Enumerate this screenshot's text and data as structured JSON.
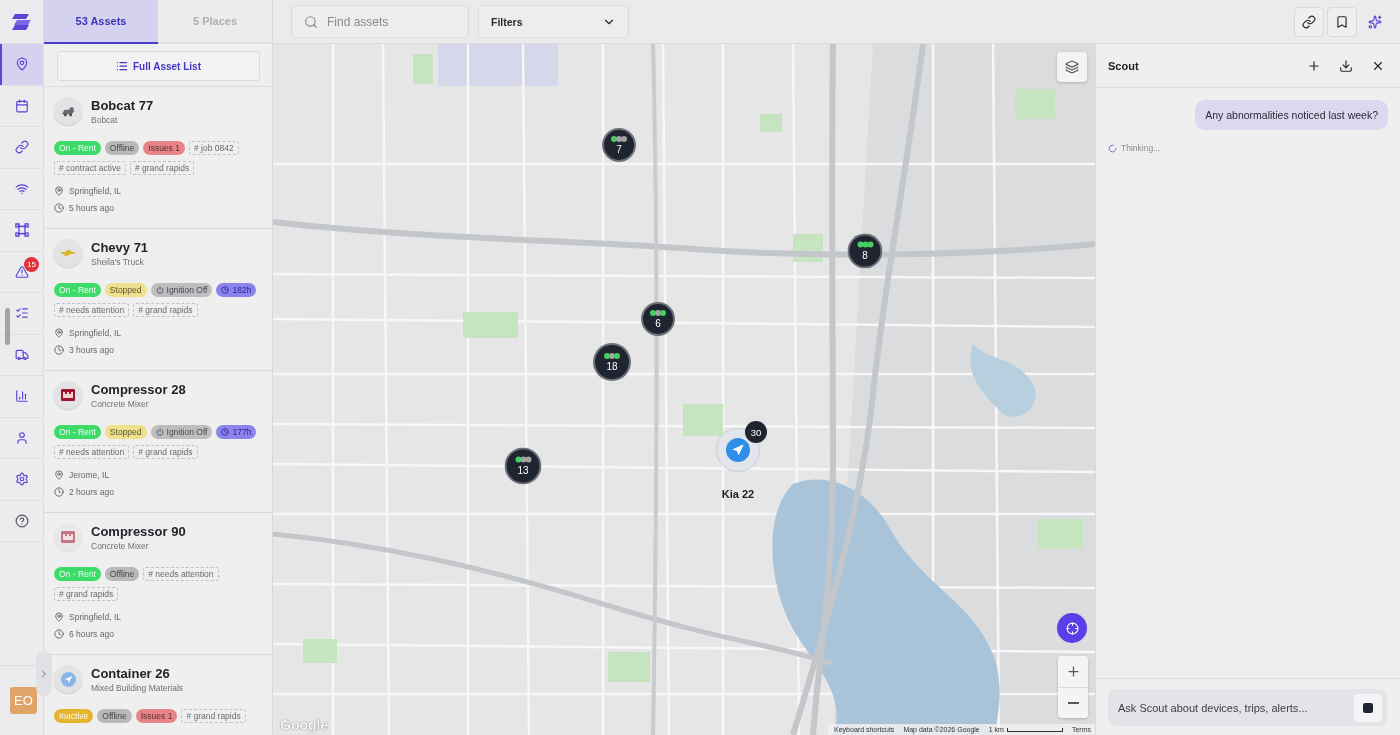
{
  "rail": {
    "nav": [
      {
        "selected": true
      },
      {
        "selected": false
      },
      {
        "selected": false
      },
      {
        "selected": false
      },
      {
        "selected": false
      },
      {
        "selected": false,
        "badge": "15"
      },
      {
        "selected": false
      },
      {
        "selected": false
      },
      {
        "selected": false
      },
      {
        "selected": false
      },
      {
        "selected": false
      },
      {
        "selected": false
      }
    ],
    "avatar": "EO"
  },
  "asset_panel": {
    "tabs": [
      {
        "label": "53 Assets",
        "selected": true
      },
      {
        "label": "5 Places",
        "selected": false
      }
    ],
    "full_list_button": "Full Asset List",
    "assets": [
      {
        "name": "Bobcat 77",
        "subtitle": "Bobcat",
        "tags": [
          {
            "kind": "status",
            "label": "On - Rent",
            "color": "#3ddc6a"
          },
          {
            "kind": "status",
            "label": "Offline",
            "color": "#b9b9b9"
          },
          {
            "kind": "status",
            "label": "Issues 1",
            "color": "#e88388"
          },
          {
            "kind": "hashtag",
            "label": "# job 0842"
          },
          {
            "kind": "hashtag",
            "label": "# contract active"
          },
          {
            "kind": "hashtag",
            "label": "# grand rapids"
          }
        ],
        "location": "Springfield, IL",
        "last_seen": "5 hours ago"
      },
      {
        "name": "Chevy 71",
        "subtitle": "Sheila's Truck",
        "tags": [
          {
            "kind": "status",
            "label": "On - Rent",
            "color": "#3ddc6a"
          },
          {
            "kind": "status",
            "label": "Stopped",
            "color": "#efe08c"
          },
          {
            "kind": "ignition",
            "label": "Ignition Off"
          },
          {
            "kind": "hours",
            "label": "182h"
          },
          {
            "kind": "hashtag",
            "label": "# needs attention"
          },
          {
            "kind": "hashtag",
            "label": "# grand rapids"
          }
        ],
        "location": "Springfield, IL",
        "last_seen": "3 hours ago"
      },
      {
        "name": "Compressor 28",
        "subtitle": "Concrete Mixer",
        "tags": [
          {
            "kind": "status",
            "label": "On - Rent",
            "color": "#3ddc6a"
          },
          {
            "kind": "status",
            "label": "Stopped",
            "color": "#efe08c"
          },
          {
            "kind": "ignition",
            "label": "Ignition Off"
          },
          {
            "kind": "hours",
            "label": "177h"
          },
          {
            "kind": "hashtag",
            "label": "# needs attention"
          },
          {
            "kind": "hashtag",
            "label": "# grand rapids"
          }
        ],
        "location": "Jerome, IL",
        "last_seen": "2 hours ago"
      },
      {
        "name": "Compressor 90",
        "subtitle": "Concrete Mixer",
        "tags": [
          {
            "kind": "status",
            "label": "On - Rent",
            "color": "#3ddc6a"
          },
          {
            "kind": "status",
            "label": "Offline",
            "color": "#b9b9b9"
          },
          {
            "kind": "hashtag",
            "label": "# needs attention"
          },
          {
            "kind": "hashtag",
            "label": "# grand rapids"
          }
        ],
        "location": "Springfield, IL",
        "last_seen": "6 hours ago"
      },
      {
        "name": "Container 26",
        "subtitle": "Mixed Building Materials",
        "tags": [
          {
            "kind": "status",
            "label": "Inactive",
            "color": "#e3b52e"
          },
          {
            "kind": "status",
            "label": "Offline",
            "color": "#b9b9b9"
          },
          {
            "kind": "status",
            "label": "Issues 1",
            "color": "#e88388"
          },
          {
            "kind": "hashtag",
            "label": "# grand rapids"
          }
        ]
      }
    ]
  },
  "top_bar": {
    "search": {
      "placeholder": "Find assets"
    },
    "filter": {
      "label": "Filters"
    }
  },
  "map": {
    "clusters": [
      {
        "count": "7",
        "dots": [
          {
            "color": "#44d15e"
          },
          {
            "color": "#a3a3a3"
          },
          {
            "color": "#a3a3a3"
          }
        ]
      },
      {
        "count": "8",
        "dots": [
          {
            "color": "#44d15e"
          },
          {
            "color": "#44d15e"
          },
          {
            "color": "#44d15e"
          }
        ]
      },
      {
        "count": "6",
        "dots": [
          {
            "color": "#44d15e"
          },
          {
            "color": "#a3a3a3"
          },
          {
            "color": "#44d15e"
          }
        ]
      },
      {
        "count": "18",
        "dots": [
          {
            "color": "#44d15e"
          },
          {
            "color": "#a3a3a3"
          },
          {
            "color": "#44d15e"
          }
        ]
      },
      {
        "count": "13",
        "dots": [
          {
            "color": "#44d15e"
          },
          {
            "color": "#a3a3a3"
          },
          {
            "color": "#a3a3a3"
          }
        ]
      }
    ],
    "vehicle": {
      "label": "Kia 22",
      "badge": "30"
    },
    "attribution": {
      "logo": "Google",
      "keyboard": "Keyboard shortcuts",
      "data": "Map data ©2026 Google",
      "scale": "1 km",
      "terms": "Terms"
    }
  },
  "scout": {
    "title": "Scout",
    "messages": [
      {
        "kind": "user",
        "text": "Any abnormalities noticed last week?"
      }
    ],
    "status": "Thinking...",
    "input": {
      "placeholder": "Ask Scout about devices, trips, alerts..."
    }
  }
}
